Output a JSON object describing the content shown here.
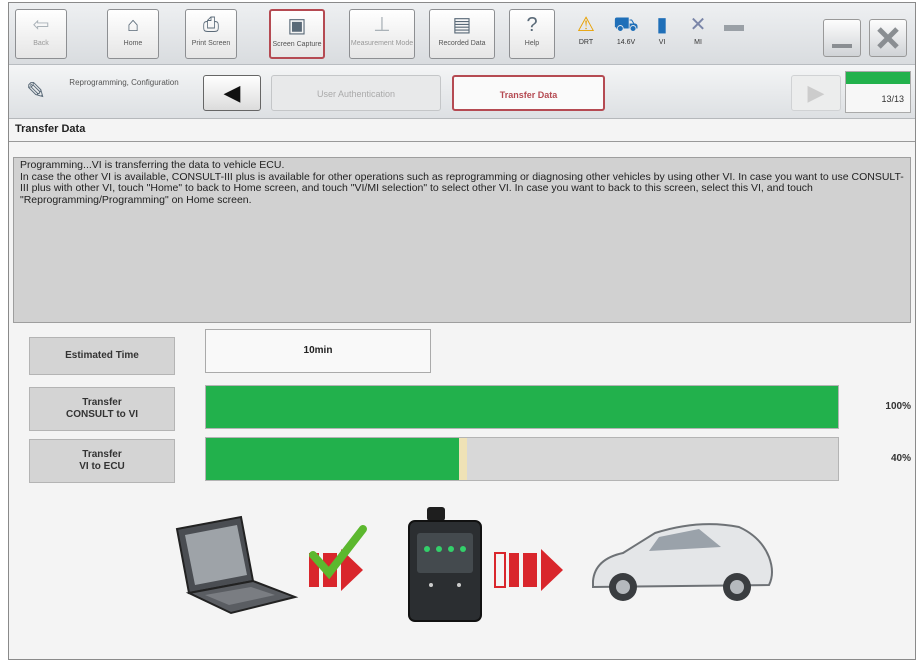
{
  "toolbar": {
    "buttons": [
      {
        "label": "Back",
        "icon": "back-arrow-icon"
      },
      {
        "label": "Home",
        "icon": "home-icon"
      },
      {
        "label": "Print Screen",
        "icon": "printer-icon"
      },
      {
        "label": "Screen Capture",
        "icon": "camera-icon"
      },
      {
        "label": "Measurement Mode",
        "icon": "measurement-icon"
      },
      {
        "label": "Recorded Data",
        "icon": "recorded-data-icon"
      },
      {
        "label": "Help",
        "icon": "help-icon"
      }
    ],
    "status": [
      {
        "label": "DRT",
        "icon": "warning-icon"
      },
      {
        "label": "14.6V",
        "icon": "car-battery-icon"
      },
      {
        "label": "VI",
        "icon": "signal-icon"
      },
      {
        "label": "MI",
        "icon": "mi-x-icon"
      }
    ]
  },
  "nav": {
    "section_label": "Reprogramming, Configuration",
    "steps": [
      "User Authentication",
      "Transfer Data"
    ],
    "step_counter": "13/13",
    "step_progress": 1.0
  },
  "page": {
    "title": "Transfer Data",
    "message": [
      "Programming...VI is transferring the data to vehicle ECU.",
      "In case the other VI is available, CONSULT-III plus is available for other operations such as reprogramming or diagnosing other vehicles by using other VI. In case you want to use CONSULT-III plus with other VI, touch \"Home\" to back to Home screen, and touch \"VI/MI selection\" to select other VI. In case you want to back to this screen, select this VI, and touch \"Reprogramming/Programming\" on Home screen."
    ]
  },
  "estimate": {
    "label": "Estimated Time",
    "value": "10min"
  },
  "transfers": [
    {
      "label_line1": "Transfer",
      "label_line2": "CONSULT to VI",
      "percent_text": "100%",
      "progress": 1.0
    },
    {
      "label_line1": "Transfer",
      "label_line2": "VI to ECU",
      "percent_text": "40%",
      "progress": 0.4
    }
  ],
  "colors": {
    "progress_green": "#22b14c",
    "accent_red": "#b54a52",
    "arrow_red": "#d9262c"
  }
}
